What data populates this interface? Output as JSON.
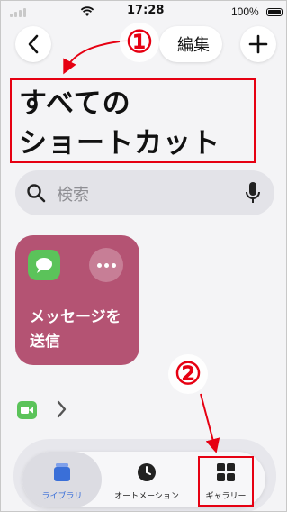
{
  "status_bar": {
    "time": "17:28",
    "battery": "100%"
  },
  "nav": {
    "edit_label": "編集"
  },
  "annotations": {
    "one": "①",
    "two": "②"
  },
  "page": {
    "title_line1": "すべての",
    "title_line2": "ショートカット"
  },
  "search": {
    "placeholder": "検索"
  },
  "shortcut_card": {
    "title": "メッセージを送信",
    "color": "#b45373"
  },
  "tab_bar": {
    "library": "ライブラリ",
    "automation": "オートメーション",
    "gallery": "ギャラリー"
  },
  "colors": {
    "accent": "#3a6fd8",
    "annotation": "#e60012"
  }
}
